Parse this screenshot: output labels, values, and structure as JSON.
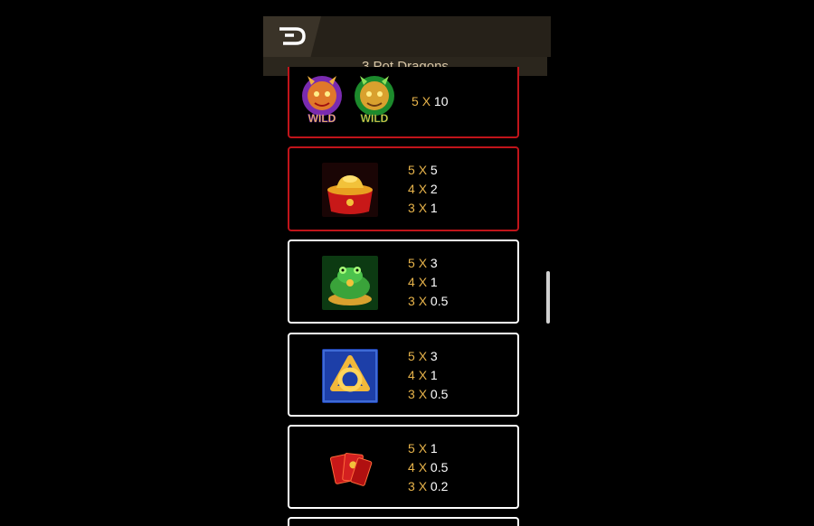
{
  "header": {
    "back_icon": "back-arrow-icon",
    "title": "3 Pot Dragons"
  },
  "cards": [
    {
      "symbol": "wild-dragons",
      "border": "red",
      "payouts": [
        {
          "count": "5",
          "x": "X",
          "value": "10"
        }
      ]
    },
    {
      "symbol": "gold-ingot-pot",
      "border": "red",
      "payouts": [
        {
          "count": "5",
          "x": "X",
          "value": "5"
        },
        {
          "count": "4",
          "x": "X",
          "value": "2"
        },
        {
          "count": "3",
          "x": "X",
          "value": "1"
        }
      ]
    },
    {
      "symbol": "jade-toad",
      "border": "white",
      "payouts": [
        {
          "count": "5",
          "x": "X",
          "value": "3"
        },
        {
          "count": "4",
          "x": "X",
          "value": "1"
        },
        {
          "count": "3",
          "x": "X",
          "value": "0.5"
        }
      ]
    },
    {
      "symbol": "golden-knot",
      "border": "white",
      "payouts": [
        {
          "count": "5",
          "x": "X",
          "value": "3"
        },
        {
          "count": "4",
          "x": "X",
          "value": "1"
        },
        {
          "count": "3",
          "x": "X",
          "value": "0.5"
        }
      ]
    },
    {
      "symbol": "red-envelopes",
      "border": "white",
      "payouts": [
        {
          "count": "5",
          "x": "X",
          "value": "1"
        },
        {
          "count": "4",
          "x": "X",
          "value": "0.5"
        },
        {
          "count": "3",
          "x": "X",
          "value": "0.2"
        }
      ]
    }
  ],
  "wild_labels": [
    "WILD",
    "WILD"
  ],
  "colors": {
    "gold": "#e8b44b",
    "red_border": "#c0141a",
    "title_text": "#d9c7a7"
  }
}
